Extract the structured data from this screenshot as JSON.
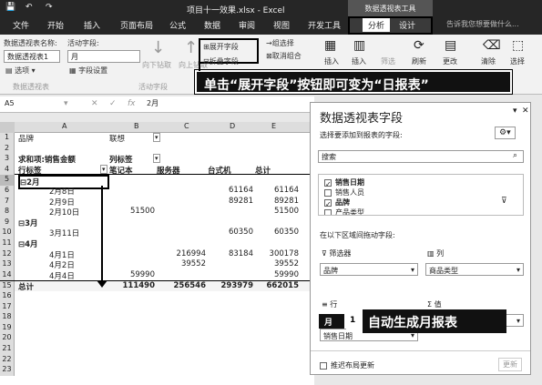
{
  "window": {
    "title": "项目十一效果.xlsx - Excel",
    "tools_label": "数据透视表工具"
  },
  "tabs": [
    "文件",
    "开始",
    "插入",
    "页面布局",
    "公式",
    "数据",
    "审阅",
    "视图",
    "开发工具",
    "分析",
    "设计"
  ],
  "tell_me": "告诉我您想要做什么...",
  "ribbon": {
    "pt_name_label": "数据透视表名称:",
    "pt_name_value": "数据透视表1",
    "options_label": "选项",
    "group1": "数据透视表",
    "active_field_label": "活动字段:",
    "active_field_value": "月",
    "field_settings": "字段设置",
    "drill_down": "向下钻取",
    "drill_up": "向上钻取",
    "expand_field": "展开字段",
    "collapse_field": "折叠字段",
    "group2": "活动字段",
    "group_selection": "→组选择",
    "ungroup": "取消组合",
    "group_field": "组字段",
    "insert_slicer": "插入",
    "insert_timeline": "插入",
    "filter_conn": "筛选",
    "refresh": "刷新",
    "change_source": "更改",
    "clear": "清除",
    "select": "选择"
  },
  "callout_top": "单击“展开字段”按钮即可变为“日报表”",
  "callout_bottom": "自动生成月报表",
  "formula_bar": {
    "name_box": "A5",
    "fx": "fx",
    "value": "2月"
  },
  "col_headers": [
    "A",
    "B",
    "C",
    "D",
    "E"
  ],
  "rows": [
    {
      "n": "1",
      "a": "品牌",
      "b": "联想",
      "filter": true
    },
    {
      "n": "2",
      "a": ""
    },
    {
      "n": "3",
      "a": "求和项:销售金额",
      "b": "列标签",
      "bold": true
    },
    {
      "n": "4",
      "a": "行标签",
      "b": "笔记本",
      "c": "服务器",
      "d": "台式机",
      "e": "总计",
      "bold": true
    },
    {
      "n": "5",
      "a": "⊟2月",
      "bold": true,
      "sel": true
    },
    {
      "n": "6",
      "a": "2月8日",
      "ind": true,
      "d": "61164",
      "e": "61164"
    },
    {
      "n": "7",
      "a": "2月9日",
      "ind": true,
      "d": "89281",
      "e": "89281"
    },
    {
      "n": "8",
      "a": "2月10日",
      "ind": true,
      "b": "51500",
      "e": "51500"
    },
    {
      "n": "9",
      "a": "⊟3月",
      "bold": true
    },
    {
      "n": "10",
      "a": "3月11日",
      "ind": true,
      "d": "60350",
      "e": "60350"
    },
    {
      "n": "11",
      "a": "⊟4月",
      "bold": true
    },
    {
      "n": "12",
      "a": "4月1日",
      "ind": true,
      "c": "216994",
      "d": "83184",
      "e": "300178"
    },
    {
      "n": "13",
      "a": "4月2日",
      "ind": true,
      "c": "39552",
      "e": "39552"
    },
    {
      "n": "14",
      "a": "4月4日",
      "ind": true,
      "b": "59990",
      "e": "59990"
    },
    {
      "n": "15",
      "a": "总计",
      "b": "111490",
      "c": "256546",
      "d": "293979",
      "e": "662015",
      "bold": true,
      "total": true
    },
    {
      "n": "16"
    },
    {
      "n": "17"
    },
    {
      "n": "18"
    },
    {
      "n": "19"
    },
    {
      "n": "20"
    },
    {
      "n": "21"
    },
    {
      "n": "22"
    },
    {
      "n": "23"
    }
  ],
  "pane": {
    "title": "数据透视表字段",
    "choose": "选择要添加到报表的字段:",
    "search_placeholder": "搜索",
    "fields": [
      {
        "name": "销售日期",
        "checked": true
      },
      {
        "name": "销售人员",
        "checked": false
      },
      {
        "name": "品牌",
        "checked": true
      },
      {
        "name": "产品类型",
        "checked": false
      }
    ],
    "drag": "在以下区域间拖动字段:",
    "filters_label": "筛选器",
    "columns_label": "列",
    "rows_label": "行",
    "values_label": "值",
    "filter_item": "品牌",
    "column_item": "商品类型",
    "row_item1": "月",
    "row_item2": "销售日期",
    "defer": "推迟布局更新",
    "update": "更新"
  }
}
